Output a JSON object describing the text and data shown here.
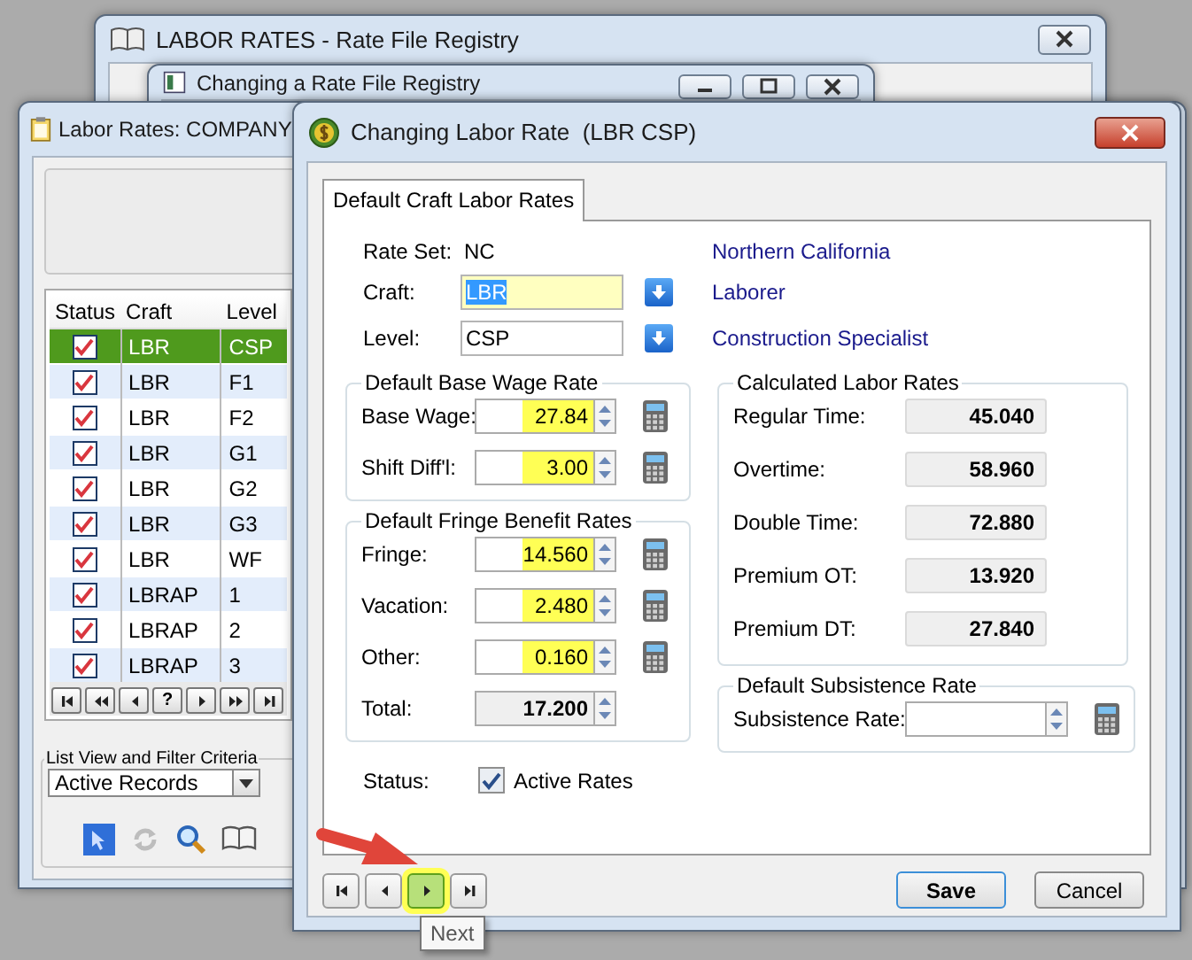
{
  "registry_window": {
    "title": "LABOR RATES - Rate File Registry"
  },
  "registry_dialog": {
    "title": "Changing a Rate File Registry"
  },
  "list_window": {
    "title": "Labor Rates: COMPANY",
    "columns": [
      "Status",
      "Craft",
      "Level"
    ],
    "rows": [
      {
        "status": true,
        "craft": "LBR",
        "level": "CSP",
        "selected": true
      },
      {
        "status": true,
        "craft": "LBR",
        "level": "F1",
        "selected": false
      },
      {
        "status": true,
        "craft": "LBR",
        "level": "F2",
        "selected": false
      },
      {
        "status": true,
        "craft": "LBR",
        "level": "G1",
        "selected": false
      },
      {
        "status": true,
        "craft": "LBR",
        "level": "G2",
        "selected": false
      },
      {
        "status": true,
        "craft": "LBR",
        "level": "G3",
        "selected": false
      },
      {
        "status": true,
        "craft": "LBR",
        "level": "WF",
        "selected": false
      },
      {
        "status": true,
        "craft": "LBRAP",
        "level": "1",
        "selected": false
      },
      {
        "status": true,
        "craft": "LBRAP",
        "level": "2",
        "selected": false
      },
      {
        "status": true,
        "craft": "LBRAP",
        "level": "3",
        "selected": false
      }
    ],
    "nav": [
      {
        "kind": "first"
      },
      {
        "kind": "prev-page"
      },
      {
        "kind": "prev"
      },
      {
        "kind": "help",
        "label": "?"
      },
      {
        "kind": "next"
      },
      {
        "kind": "next-page"
      },
      {
        "kind": "last"
      }
    ],
    "filter": {
      "title": "List View and Filter Criteria",
      "value": "Active Records"
    },
    "tools": [
      {
        "kind": "select",
        "disabled": false
      },
      {
        "kind": "refresh",
        "disabled": true
      },
      {
        "kind": "search",
        "disabled": false
      },
      {
        "kind": "book",
        "disabled": false
      }
    ]
  },
  "dialog": {
    "title": "Changing Labor Rate  (LBR CSP)",
    "tabs": [
      {
        "label": "Default Craft Labor Rates",
        "selected": true
      }
    ],
    "header": [
      {
        "kind": "text",
        "label": "Rate Set:",
        "value": "NC",
        "description": "Northern California"
      },
      {
        "kind": "lookup",
        "label": "Craft:",
        "value": "LBR",
        "description": "Laborer",
        "focused": true
      },
      {
        "kind": "lookup",
        "label": "Level:",
        "value": "CSP",
        "description": "Construction Specialist",
        "focused": false
      }
    ],
    "base_wage": {
      "title": "Default Base Wage Rate",
      "fields": [
        {
          "label": "Base Wage:",
          "value": "27.84",
          "highlighted": true,
          "calculator": true,
          "readonly": false
        },
        {
          "label": "Shift Diff'l:",
          "value": "3.00",
          "highlighted": true,
          "calculator": true,
          "readonly": false
        }
      ]
    },
    "fringe": {
      "title": "Default Fringe Benefit Rates",
      "fields": [
        {
          "label": "Fringe:",
          "value": "14.560",
          "highlighted": true,
          "calculator": true,
          "readonly": false
        },
        {
          "label": "Vacation:",
          "value": "2.480",
          "highlighted": true,
          "calculator": true,
          "readonly": false
        },
        {
          "label": "Other:",
          "value": "0.160",
          "highlighted": true,
          "calculator": true,
          "readonly": false
        },
        {
          "label": "Total:",
          "value": "17.200",
          "highlighted": false,
          "calculator": false,
          "readonly": true
        }
      ]
    },
    "calculated": {
      "title": "Calculated Labor Rates",
      "fields": [
        {
          "label": "Regular Time:",
          "value": "45.040"
        },
        {
          "label": "Overtime:",
          "value": "58.960"
        },
        {
          "label": "Double Time:",
          "value": "72.880"
        },
        {
          "label": "Premium OT:",
          "value": "13.920"
        },
        {
          "label": "Premium DT:",
          "value": "27.840"
        }
      ]
    },
    "subsistence": {
      "title": "Default Subsistence Rate",
      "fields": [
        {
          "label": "Subsistence Rate:",
          "highlighted": false,
          "calculator": true,
          "readonly": false
        }
      ]
    },
    "status": {
      "label": "Status:",
      "checkbox": "Active Rates",
      "checked": true
    },
    "nav": [
      {
        "kind": "first",
        "highlighted": false
      },
      {
        "kind": "prev",
        "highlighted": false
      },
      {
        "kind": "next",
        "highlighted": true
      },
      {
        "kind": "last",
        "highlighted": false
      }
    ],
    "buttons": [
      {
        "label": "Save",
        "default": true
      },
      {
        "label": "Cancel",
        "default": false
      }
    ],
    "tooltip": "Next"
  }
}
